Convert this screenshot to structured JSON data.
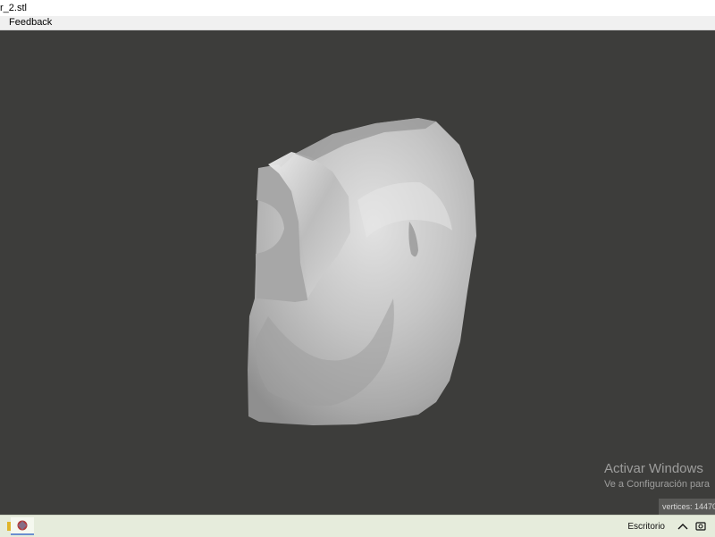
{
  "window": {
    "title": "r_2.stl"
  },
  "menu": {
    "items": [
      {
        "label": "Feedback"
      }
    ]
  },
  "viewport": {
    "background_color": "#3d3d3b",
    "model_color": "#bdbdbd"
  },
  "overlay": {
    "watermark_title": "Activar Windows",
    "watermark_subtitle": "Ve a Configuración para",
    "stats_text": "vertices: 14470"
  },
  "taskbar": {
    "apps": [
      {
        "icon": "app-icon-yellow"
      },
      {
        "icon": "stl-viewer-icon"
      }
    ],
    "desktop_label": "Escritorio",
    "tray_icons": [
      "chevron-up-icon",
      "onedrive-icon"
    ]
  }
}
